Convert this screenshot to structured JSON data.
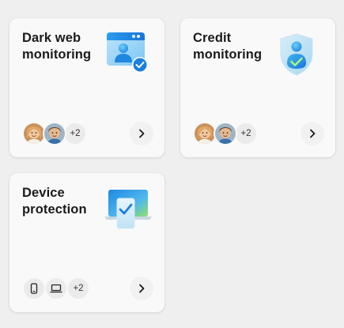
{
  "cards": [
    {
      "title": "Dark web monitoring",
      "icon": "dark-web-monitoring-icon",
      "avatars": [
        "person-avatar",
        "person-avatar"
      ],
      "more": "+2"
    },
    {
      "title": "Credit monitoring",
      "icon": "credit-shield-icon",
      "avatars": [
        "person-avatar",
        "person-avatar"
      ],
      "more": "+2"
    },
    {
      "title": "Device protection",
      "icon": "laptop-check-icon",
      "devices": [
        "phone-icon",
        "laptop-icon"
      ],
      "more": "+2"
    }
  ],
  "colors": {
    "accent_blue": "#1a7fe0",
    "card_bg": "#f9f9f9",
    "page_bg": "#efefef"
  }
}
